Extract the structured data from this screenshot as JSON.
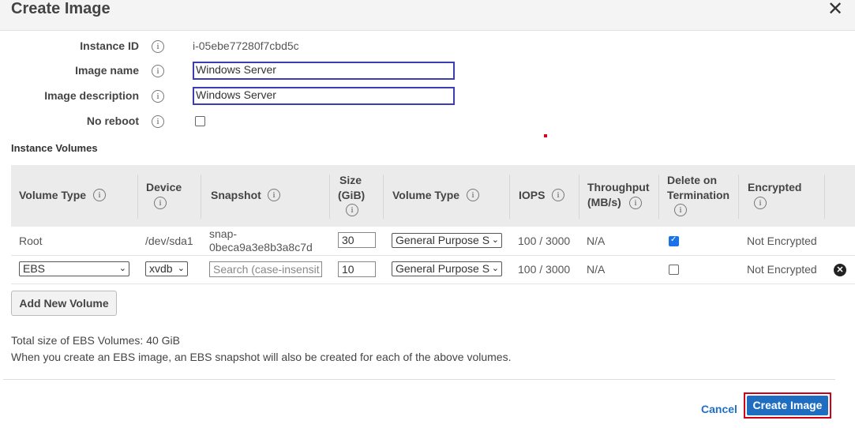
{
  "dialog": {
    "title": "Create Image",
    "close_glyph": "✕"
  },
  "form": {
    "instance_id_label": "Instance ID",
    "instance_id_value": "i-05ebe77280f7cbd5c",
    "image_name_label": "Image name",
    "image_name_value": "Windows Server",
    "image_description_label": "Image description",
    "image_description_value": "Windows Server",
    "no_reboot_label": "No reboot",
    "no_reboot_checked": false
  },
  "info_glyph": "i",
  "volumes": {
    "section_title": "Instance Volumes",
    "headers": {
      "volume_type": "Volume Type",
      "device": "Device",
      "snapshot": "Snapshot",
      "size_l1": "Size",
      "size_l2": "(GiB)",
      "volume_type2": "Volume Type",
      "iops": "IOPS",
      "throughput_l1": "Throughput",
      "throughput_l2": "(MB/s)",
      "delete_l1": "Delete on",
      "delete_l2": "Termination",
      "encrypted": "Encrypted"
    },
    "rows": [
      {
        "volume_type": "Root",
        "device": "/dev/sda1",
        "snapshot_l1": "snap-",
        "snapshot_l2": "0beca9a3e8b3a8c7d",
        "size": "30",
        "type": "General Purpose S",
        "iops": "100 / 3000",
        "throughput": "N/A",
        "delete_on_termination": true,
        "encrypted": "Not Encrypted"
      },
      {
        "volume_type": "EBS",
        "device": "xvdb",
        "snapshot_placeholder": "Search (case-insensit",
        "size": "10",
        "type": "General Purpose S",
        "iops": "100 / 3000",
        "throughput": "N/A",
        "delete_on_termination": false,
        "encrypted": "Not Encrypted"
      }
    ],
    "add_button": "Add New Volume"
  },
  "summary": {
    "total": "Total size of EBS Volumes: 40 GiB",
    "note": "When you create an EBS image, an EBS snapshot will also be created for each of the above volumes."
  },
  "footer": {
    "cancel": "Cancel",
    "create": "Create Image"
  },
  "colors": {
    "primary": "#1f6dc0",
    "highlight_border": "#d0001b",
    "input_border": "#3c3cb4"
  },
  "icons": [
    "info-icon",
    "close-icon",
    "chevron-down-icon",
    "remove-volume-icon",
    "checkbox-checked-icon"
  ]
}
